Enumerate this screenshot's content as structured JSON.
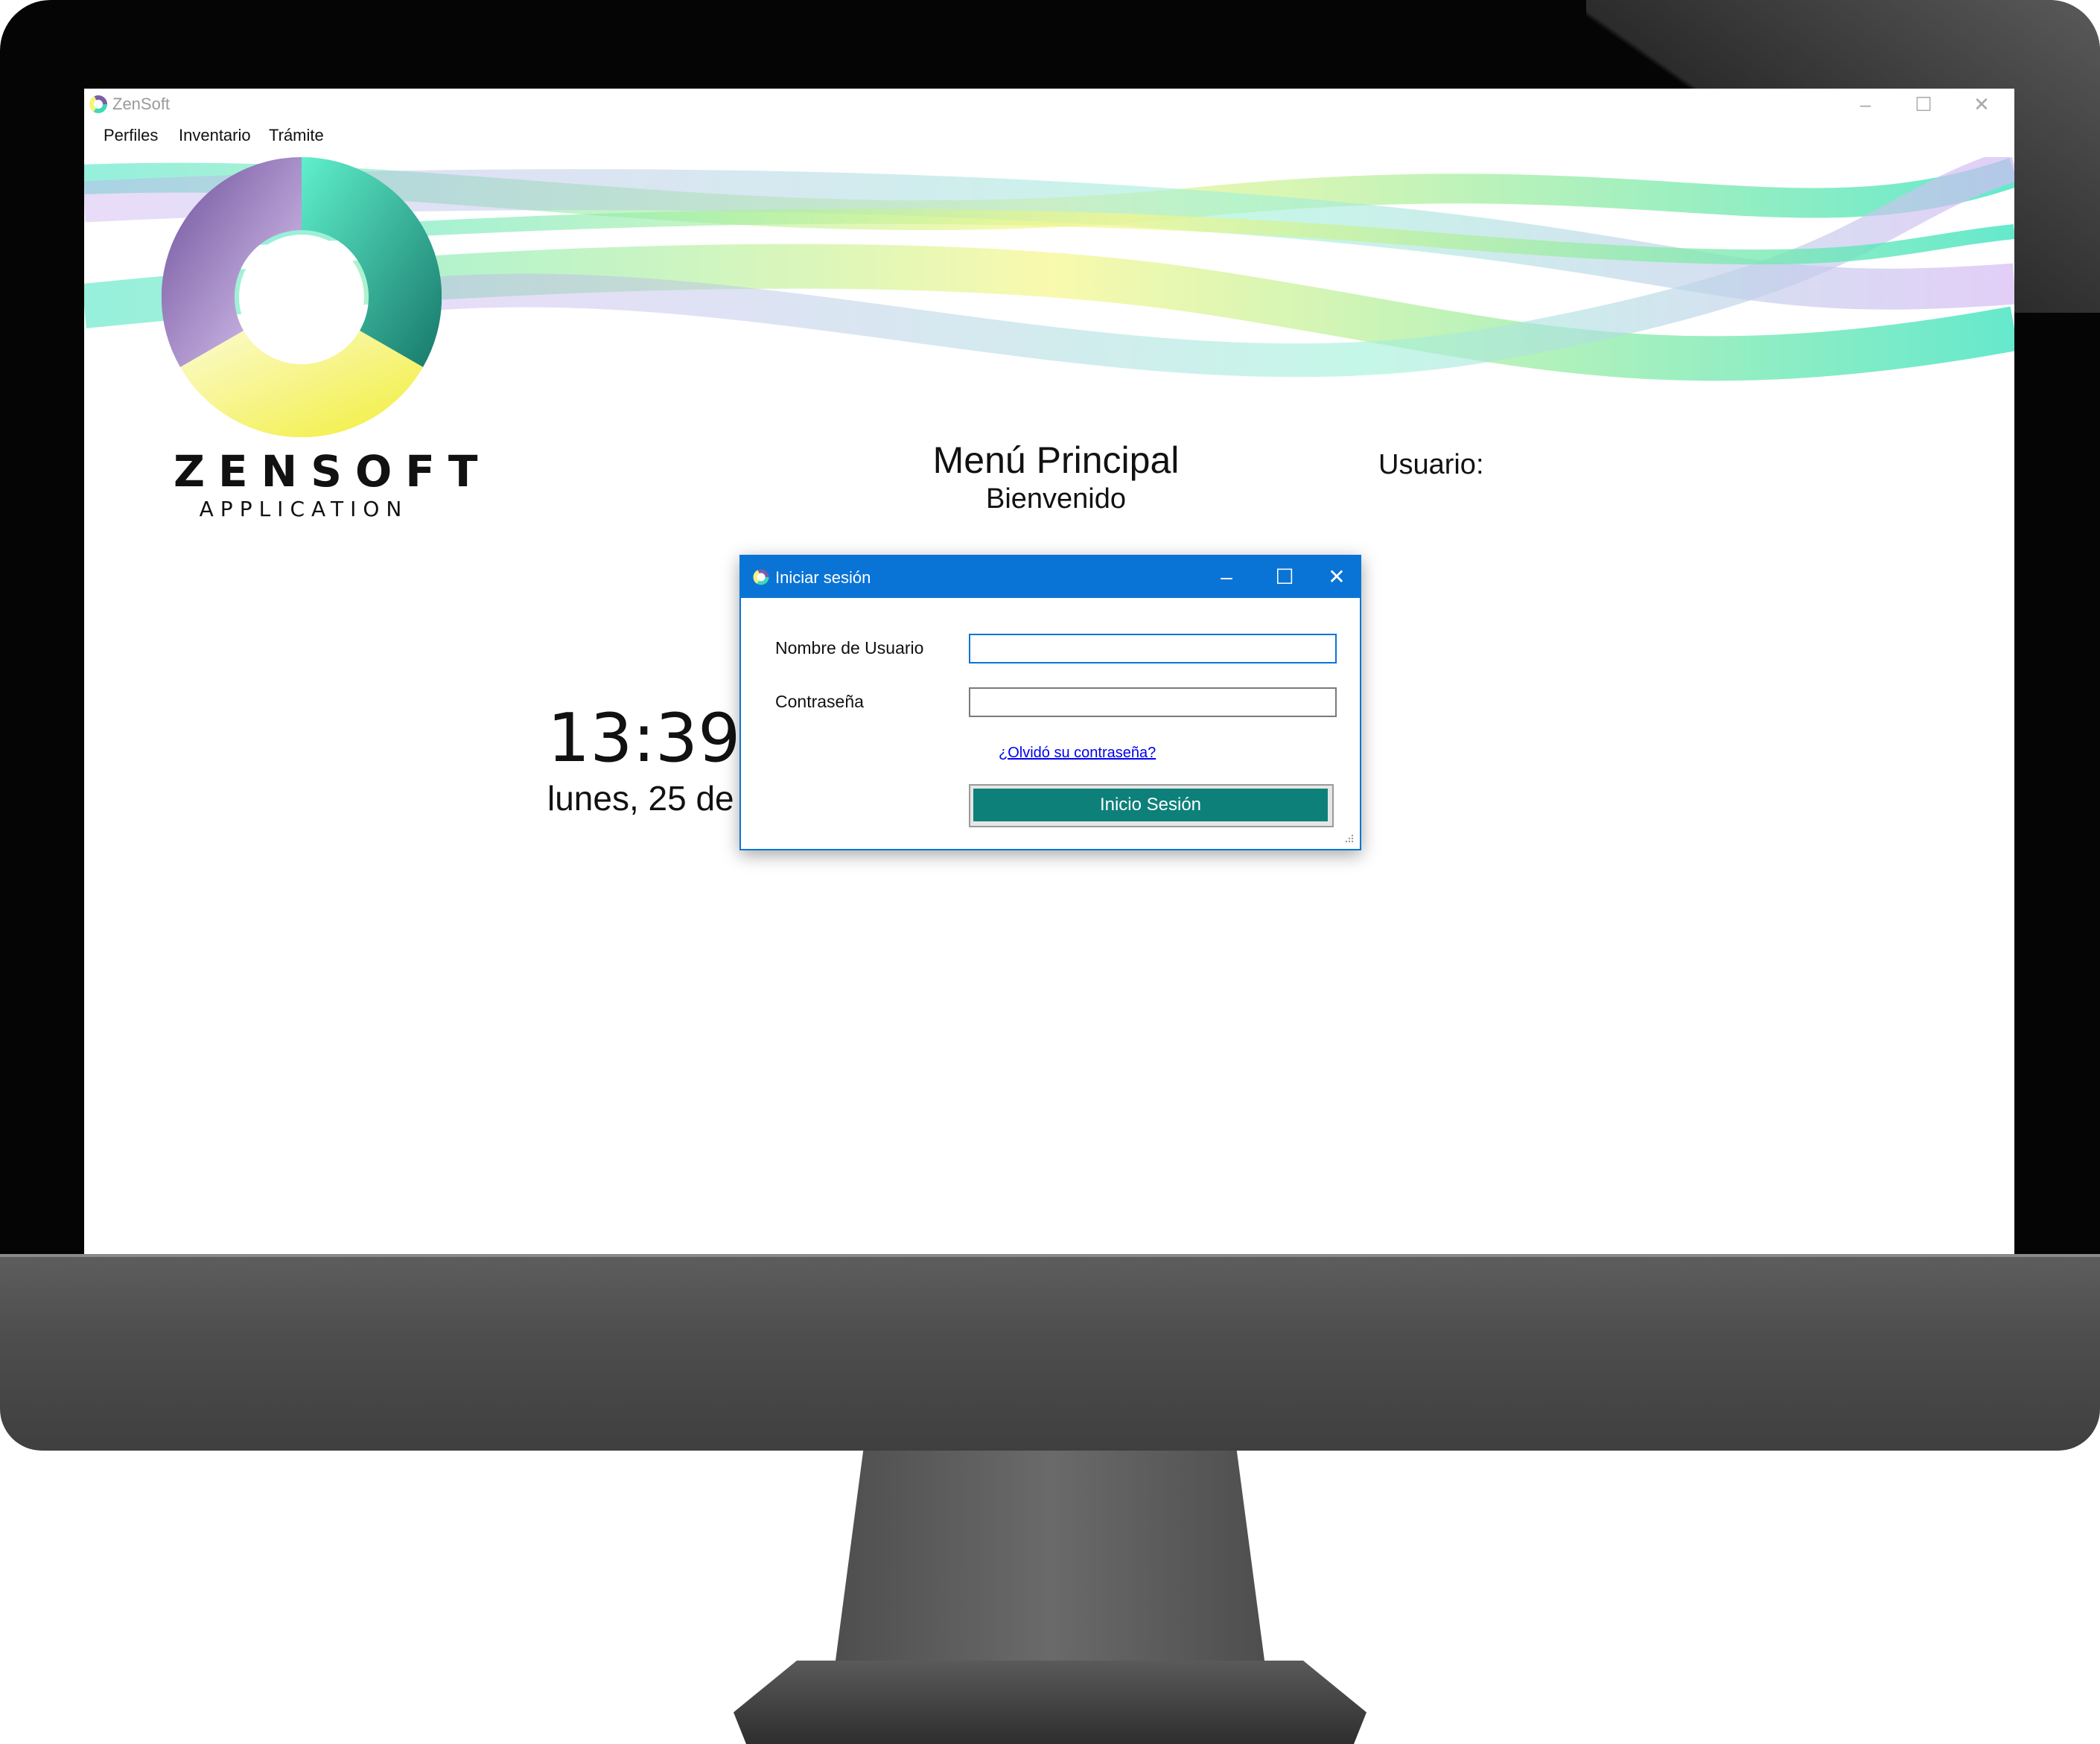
{
  "app": {
    "title": "ZenSoft",
    "window_controls": {
      "minimize": "–",
      "maximize": "☐",
      "close": "✕"
    },
    "menu": [
      "Perfiles",
      "Inventario",
      "Trámite"
    ]
  },
  "brand": {
    "name": "ZENSOFT",
    "subtitle": "APPLICATION"
  },
  "main": {
    "title": "Menú Principal",
    "subtitle": "Bienvenido",
    "user_label": "Usuario:",
    "clock": "13:39",
    "date": "lunes, 25 de"
  },
  "login_dialog": {
    "title": "Iniciar sesión",
    "controls": {
      "minimize": "–",
      "maximize": "☐",
      "close": "✕"
    },
    "username_label": "Nombre de Usuario",
    "username_value": "",
    "password_label": "Contraseña",
    "password_value": "",
    "forgot_link": "¿Olvidó su contraseña?",
    "submit_label": "Inicio Sesión"
  },
  "colors": {
    "dialog_accent": "#0a74d6",
    "button": "#0e807a",
    "link": "#0000ee",
    "logo": [
      "#7b5ea7",
      "#3fd9b8",
      "#f4f47a"
    ]
  }
}
